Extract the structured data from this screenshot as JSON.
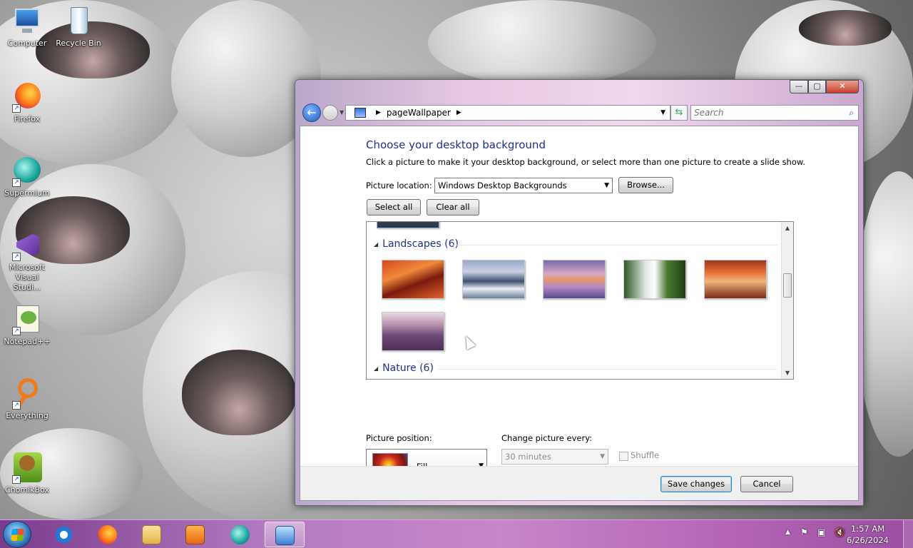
{
  "desktop": {
    "icons": [
      {
        "name": "computer",
        "label": "Computer"
      },
      {
        "name": "recycle-bin",
        "label": "Recycle Bin"
      },
      {
        "name": "firefox",
        "label": "Firefox"
      },
      {
        "name": "supermium",
        "label": "Supermium"
      },
      {
        "name": "visual-studio",
        "label": "Microsoft Visual Studi..."
      },
      {
        "name": "notepadpp",
        "label": "Notepad++"
      },
      {
        "name": "everything",
        "label": "Everything"
      },
      {
        "name": "chomikbox",
        "label": "ChomikBox"
      }
    ]
  },
  "window": {
    "caption": {
      "minimize": "—",
      "maximize": "▢",
      "close": "✕"
    },
    "address": {
      "crumb": "pageWallpaper"
    },
    "search": {
      "placeholder": "Search"
    },
    "title": "Choose your desktop background",
    "subtitle": "Click a picture to make it your desktop background, or select more than one picture to create a slide show.",
    "picture_location": {
      "label": "Picture location:",
      "value": "Windows Desktop Backgrounds",
      "browse": "Browse..."
    },
    "select_all": "Select all",
    "clear_all": "Clear all",
    "gallery": {
      "groups": [
        {
          "label": "Landscapes (6)"
        },
        {
          "label": "Nature (6)"
        }
      ]
    },
    "picture_position": {
      "label": "Picture position:",
      "value": "Fill"
    },
    "change_picture": {
      "label": "Change picture every:",
      "value": "30 minutes"
    },
    "shuffle": "Shuffle",
    "save": "Save changes",
    "cancel": "Cancel"
  },
  "taskbar": {
    "clock": {
      "time": "1:57 AM",
      "date": "6/26/2024"
    }
  }
}
